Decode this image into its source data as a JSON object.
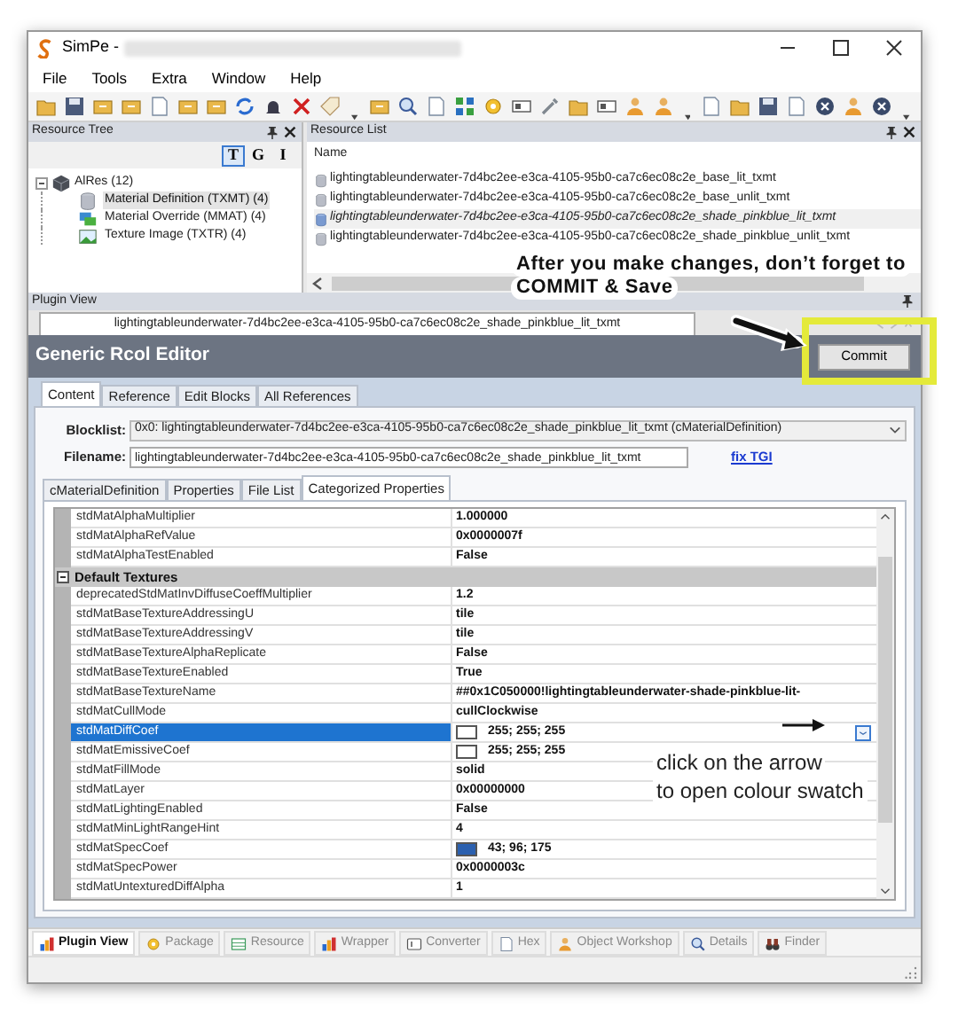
{
  "window": {
    "title": "SimPe -"
  },
  "menu": [
    "File",
    "Tools",
    "Extra",
    "Window",
    "Help"
  ],
  "resource_tree": {
    "title": "Resource Tree",
    "filter_buttons": [
      {
        "label": "T",
        "selected": true
      },
      {
        "label": "G",
        "selected": false
      },
      {
        "label": "I",
        "selected": false
      }
    ],
    "root": {
      "label": "AlRes (12)",
      "expanded": true,
      "children": [
        {
          "label": "Material Definition (TXMT) (4)",
          "selected": true
        },
        {
          "label": "Material Override (MMAT) (4)",
          "selected": false
        },
        {
          "label": "Texture Image (TXTR) (4)",
          "selected": false
        }
      ]
    }
  },
  "resource_list": {
    "title": "Resource List",
    "column": "Name",
    "items": [
      {
        "name": "lightingtableunderwater-7d4bc2ee-e3ca-4105-95b0-ca7c6ec08c2e_base_lit_txmt",
        "selected": false
      },
      {
        "name": "lightingtableunderwater-7d4bc2ee-e3ca-4105-95b0-ca7c6ec08c2e_base_unlit_txmt",
        "selected": false
      },
      {
        "name": "lightingtableunderwater-7d4bc2ee-e3ca-4105-95b0-ca7c6ec08c2e_shade_pinkblue_lit_txmt",
        "selected": true
      },
      {
        "name": "lightingtableunderwater-7d4bc2ee-e3ca-4105-95b0-ca7c6ec08c2e_shade_pinkblue_unlit_txmt",
        "selected": false
      }
    ]
  },
  "plugin_view": {
    "title": "Plugin View",
    "document_tab": "lightingtableunderwater-7d4bc2ee-e3ca-4105-95b0-ca7c6ec08c2e_shade_pinkblue_lit_txmt",
    "editor_title": "Generic Rcol Editor",
    "commit_button": "Commit",
    "tabs": [
      {
        "label": "Content",
        "selected": true
      },
      {
        "label": "Reference",
        "selected": false
      },
      {
        "label": "Edit Blocks",
        "selected": false
      },
      {
        "label": "All References",
        "selected": false
      }
    ],
    "blocklist": {
      "label": "Blocklist:",
      "value": "0x0: lightingtableunderwater-7d4bc2ee-e3ca-4105-95b0-ca7c6ec08c2e_shade_pinkblue_lit_txmt (cMaterialDefinition)"
    },
    "filename": {
      "label": "Filename:",
      "value": "lightingtableunderwater-7d4bc2ee-e3ca-4105-95b0-ca7c6ec08c2e_shade_pinkblue_lit_txmt"
    },
    "fix_link": "fix TGI",
    "inner_tabs": [
      {
        "label": "cMaterialDefinition",
        "selected": false
      },
      {
        "label": "Properties",
        "selected": false
      },
      {
        "label": "File List",
        "selected": false
      },
      {
        "label": "Categorized Properties",
        "selected": true
      }
    ],
    "properties": [
      {
        "kind": "property",
        "name": "stdMatAlphaMultiplier",
        "value": "1.000000",
        "selected": false
      },
      {
        "kind": "property",
        "name": "stdMatAlphaRefValue",
        "value": "0x0000007f",
        "selected": false
      },
      {
        "kind": "property",
        "name": "stdMatAlphaTestEnabled",
        "value": "False",
        "selected": false
      },
      {
        "kind": "category",
        "name": "Default Textures",
        "expanded": true,
        "selected": false
      },
      {
        "kind": "property",
        "name": "deprecatedStdMatInvDiffuseCoeffMultiplier",
        "value": "1.2",
        "selected": false
      },
      {
        "kind": "property",
        "name": "stdMatBaseTextureAddressingU",
        "value": "tile",
        "selected": false
      },
      {
        "kind": "property",
        "name": "stdMatBaseTextureAddressingV",
        "value": "tile",
        "selected": false
      },
      {
        "kind": "property",
        "name": "stdMatBaseTextureAlphaReplicate",
        "value": "False",
        "selected": false
      },
      {
        "kind": "property",
        "name": "stdMatBaseTextureEnabled",
        "value": "True",
        "selected": false
      },
      {
        "kind": "property",
        "name": "stdMatBaseTextureName",
        "value": "##0x1C050000!lightingtableunderwater-shade-pinkblue-lit-",
        "selected": false
      },
      {
        "kind": "property",
        "name": "stdMatCullMode",
        "value": "cullClockwise",
        "selected": false
      },
      {
        "kind": "color",
        "name": "stdMatDiffCoef",
        "value": "255; 255; 255",
        "color": "#ffffff",
        "selected": true
      },
      {
        "kind": "color",
        "name": "stdMatEmissiveCoef",
        "value": "255; 255; 255",
        "color": "#ffffff",
        "selected": false
      },
      {
        "kind": "property",
        "name": "stdMatFillMode",
        "value": "solid",
        "selected": false
      },
      {
        "kind": "property",
        "name": "stdMatLayer",
        "value": "0x00000000",
        "selected": false
      },
      {
        "kind": "property",
        "name": "stdMatLightingEnabled",
        "value": "False",
        "selected": false
      },
      {
        "kind": "property",
        "name": "stdMatMinLightRangeHint",
        "value": "4",
        "selected": false
      },
      {
        "kind": "color",
        "name": "stdMatSpecCoef",
        "value": "43; 96; 175",
        "color": "#2b60af",
        "selected": false
      },
      {
        "kind": "property",
        "name": "stdMatSpecPower",
        "value": "0x0000003c",
        "selected": false
      },
      {
        "kind": "property",
        "name": "stdMatUntexturedDiffAlpha",
        "value": "1",
        "selected": false
      }
    ]
  },
  "bottom_tabs": [
    {
      "label": "Plugin View",
      "selected": true
    },
    {
      "label": "Package",
      "selected": false
    },
    {
      "label": "Resource",
      "selected": false
    },
    {
      "label": "Wrapper",
      "selected": false
    },
    {
      "label": "Converter",
      "selected": false
    },
    {
      "label": "Hex",
      "selected": false
    },
    {
      "label": "Object Workshop",
      "selected": false
    },
    {
      "label": "Details",
      "selected": false
    },
    {
      "label": "Finder",
      "selected": false
    }
  ],
  "annotations": [
    {
      "kind": "commit",
      "lines": [
        "After you make changes, don’t forget to",
        "COMMIT & Save"
      ]
    },
    {
      "kind": "swatch",
      "lines": [
        "click on the arrow",
        "to open colour swatch"
      ]
    }
  ]
}
